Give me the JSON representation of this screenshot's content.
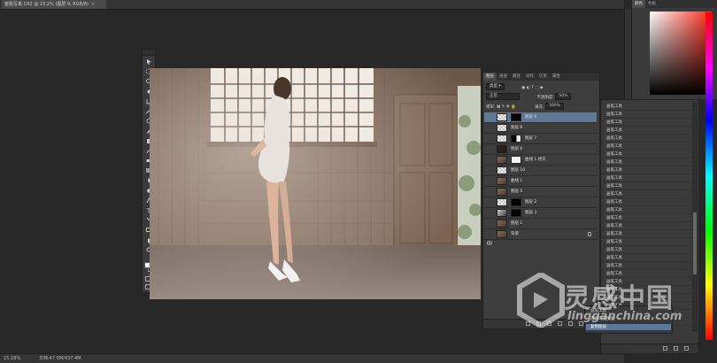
{
  "document": {
    "tab_title": "蜜桃写真.CR2 @ 15.2% (图层 9, RGB/8)",
    "zoom": "15.18%",
    "doc_info": "文档:47.5M/437.4M"
  },
  "layers_panel": {
    "tabs": [
      "图层",
      "通道",
      "路径",
      "动作",
      "历史",
      "属性"
    ],
    "active_tab": "图层",
    "filter_label": "类型",
    "blend_mode": "正常",
    "opacity_label": "不透明度:",
    "opacity_value": "50%",
    "lock_label": "锁定:",
    "fill_label": "填充:",
    "fill_value": "100%",
    "layers": [
      {
        "name": "图层 9",
        "selected": true,
        "thumb": "checker",
        "mask": "black"
      },
      {
        "name": "图层 8",
        "selected": false,
        "thumb": "checker",
        "mask": ""
      },
      {
        "name": "图层 7",
        "selected": false,
        "thumb": "checker",
        "mask": "white-shape"
      },
      {
        "name": "图层 6",
        "selected": false,
        "thumb": "dark",
        "mask": ""
      },
      {
        "name": "曲线 1 拷贝",
        "selected": false,
        "thumb": "photo",
        "mask": "white"
      },
      {
        "name": "图层 10",
        "selected": false,
        "thumb": "checker",
        "mask": ""
      },
      {
        "name": "曲线 1",
        "selected": false,
        "thumb": "photo",
        "mask": ""
      },
      {
        "name": "图层 5",
        "selected": false,
        "thumb": "photo",
        "mask": ""
      },
      {
        "name": "图层 2",
        "selected": false,
        "thumb": "checker",
        "mask": "black"
      },
      {
        "name": "图层 3",
        "selected": false,
        "thumb": "photo-bw",
        "mask": "black"
      },
      {
        "name": "图层 1",
        "selected": false,
        "thumb": "photo",
        "mask": ""
      },
      {
        "name": "背景",
        "selected": false,
        "thumb": "photo",
        "mask": "",
        "locked": true
      }
    ]
  },
  "history_panel": {
    "items": [
      "画笔工具",
      "画笔工具",
      "画笔工具",
      "画笔工具",
      "画笔工具",
      "画笔工具",
      "画笔工具",
      "画笔工具",
      "画笔工具",
      "画笔工具",
      "画笔工具",
      "画笔工具",
      "画笔工具",
      "画笔工具",
      "画笔工具",
      "画笔工具",
      "画笔工具",
      "画笔工具",
      "画笔工具",
      "画笔工具",
      "画笔工具",
      "画笔工具",
      "画笔工具",
      "画笔工具",
      "画笔工具",
      "画笔工具",
      "画笔工具",
      "画笔工具"
    ],
    "overlay_items": [
      "画笔工具",
      "盖印可见图层",
      "复制图层"
    ]
  },
  "color_panel": {
    "tabs": [
      "颜色",
      "色板"
    ],
    "active_tab": "颜色",
    "hue_color": "#ff2a1a"
  },
  "watermark": {
    "cn": "灵感中国",
    "en": "lingganchina.com"
  }
}
